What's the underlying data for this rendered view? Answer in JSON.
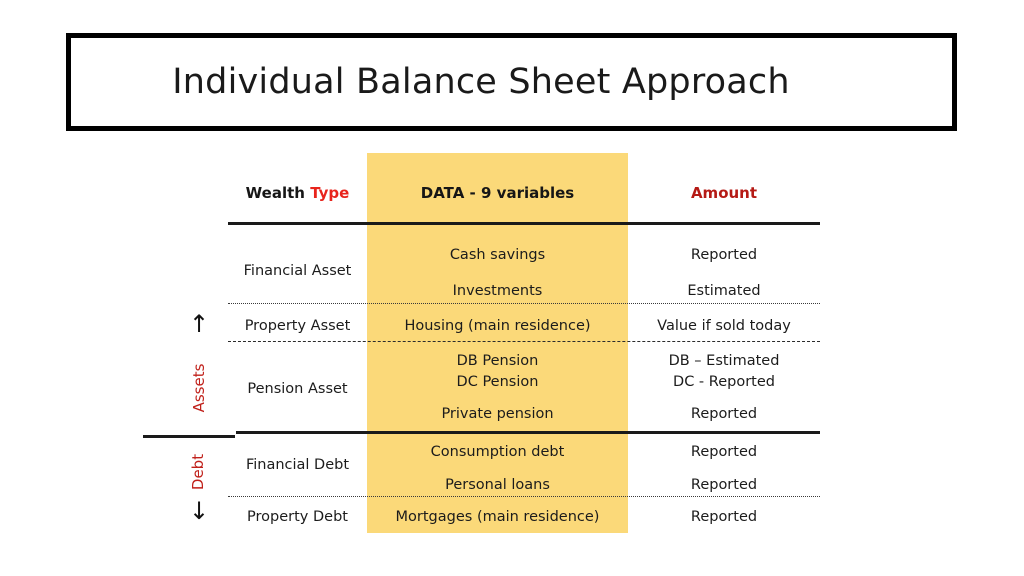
{
  "slide": {
    "title": "Individual Balance Sheet Approach"
  },
  "table": {
    "headers": {
      "type_black": "Wealth",
      "type_red": "Type",
      "data": "DATA - 9 variables",
      "amount": "Amount"
    },
    "side_labels": {
      "assets": "Assets",
      "debt": "Debt",
      "arrow_up": "↑",
      "arrow_down": "↓"
    },
    "wealth_types": [
      "Financial Asset",
      "Property Asset",
      "Pension Asset",
      "Financial Debt",
      "Property Debt"
    ],
    "rows": [
      {
        "data": "Cash savings",
        "amount": "Reported"
      },
      {
        "data": "Investments",
        "amount": "Estimated"
      },
      {
        "data": "Housing (main residence)",
        "amount": "Value if sold today"
      },
      {
        "data_line1": "DB Pension",
        "data_line2": "DC Pension",
        "amount_line1": "DB – Estimated",
        "amount_line2": "DC - Reported"
      },
      {
        "data": "Private pension",
        "amount": "Reported"
      },
      {
        "data": "Consumption debt",
        "amount": "Reported"
      },
      {
        "data": "Personal loans",
        "amount": "Reported"
      },
      {
        "data": "Mortgages (main residence)",
        "amount": "Reported"
      }
    ]
  },
  "colors": {
    "highlight": "#FBD979",
    "red_bright": "#E8241C",
    "red_dark": "#B51A15",
    "side_red": "#C0201A",
    "text": "#1c1c1c",
    "rule": "#1a1a1a"
  }
}
